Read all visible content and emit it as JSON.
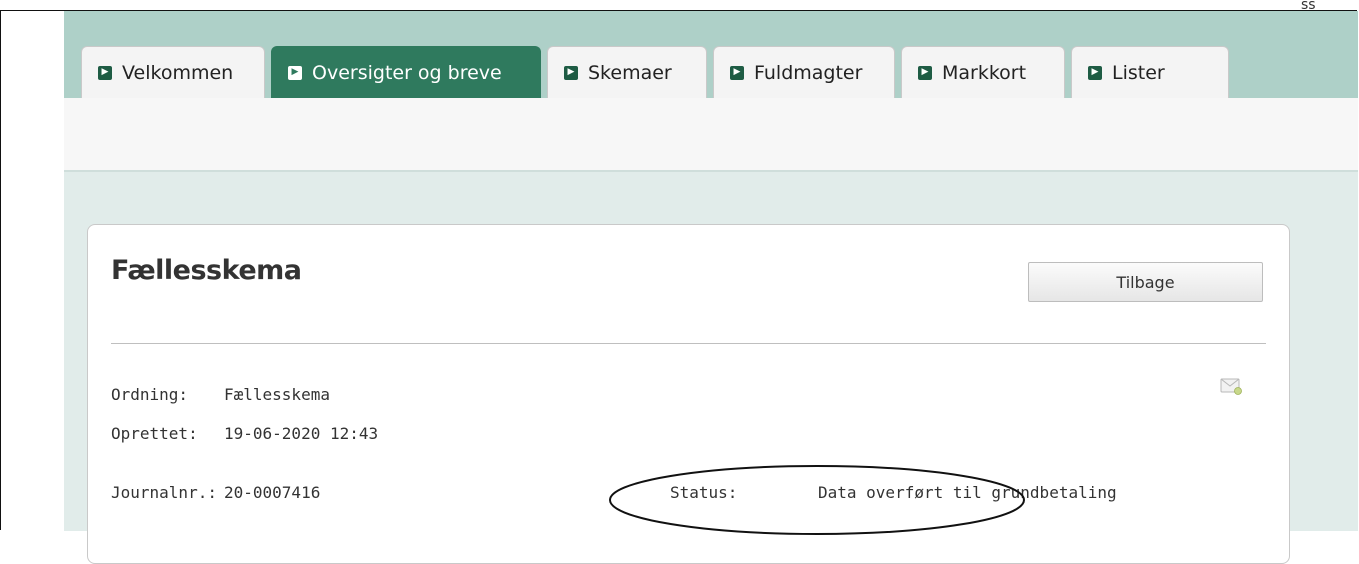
{
  "tabs": [
    {
      "label": "Velkommen",
      "active": false
    },
    {
      "label": "Oversigter og breve",
      "active": true
    },
    {
      "label": "Skemaer",
      "active": false
    },
    {
      "label": "Fuldmagter",
      "active": false
    },
    {
      "label": "Markkort",
      "active": false
    },
    {
      "label": "Lister",
      "active": false
    }
  ],
  "corner_text": "ss",
  "panel": {
    "title": "Fællesskema",
    "back_label": "Tilbage",
    "ordning_label": "Ordning:",
    "ordning_value": "Fællesskema",
    "oprettet_label": "Oprettet:",
    "oprettet_value": "19-06-2020 12:43",
    "journal_label": "Journalnr.:",
    "journal_value": "20-0007416",
    "status_label": "Status:",
    "status_value": "Data overført til grundbetaling"
  },
  "icons": {
    "tab_arrow": "chevron-right-icon",
    "mail": "envelope-icon"
  },
  "colors": {
    "tab_band": "#aed0c8",
    "active_tab": "#2f7a5e",
    "page_background": "#e1ecea",
    "annotation_ellipse": "#111111"
  }
}
